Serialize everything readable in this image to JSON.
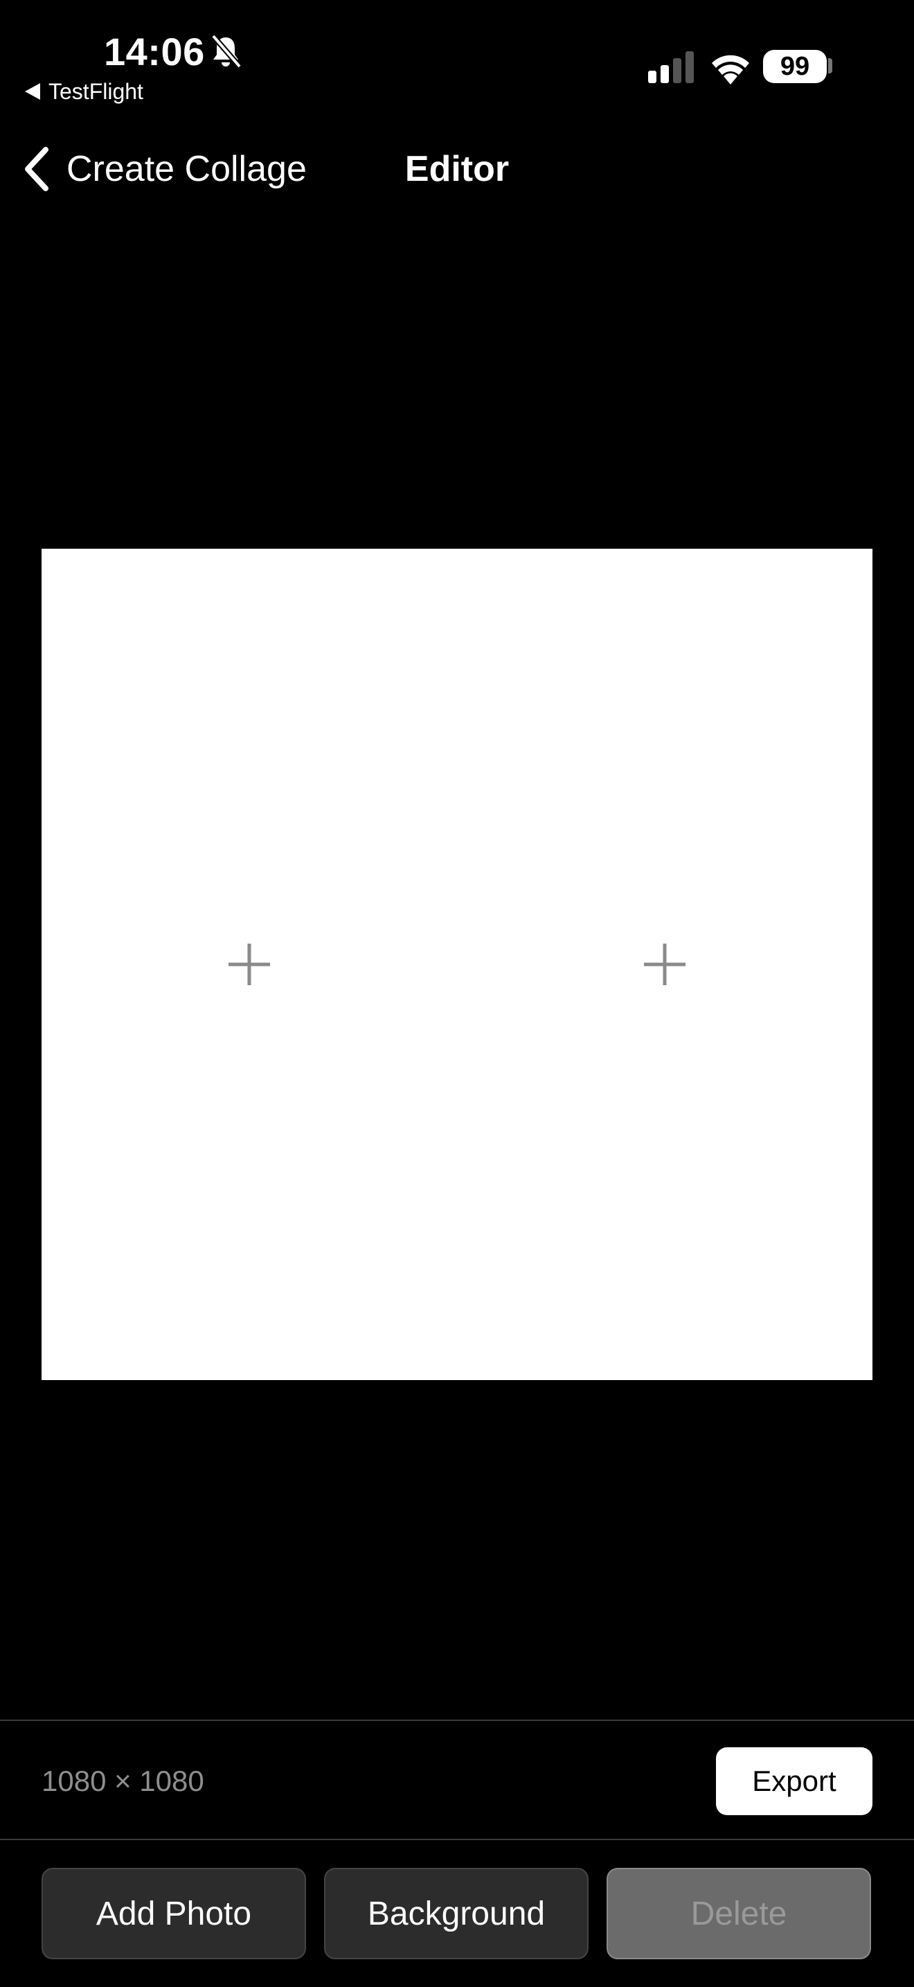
{
  "status_bar": {
    "time": "14:06",
    "back_app": "TestFlight",
    "battery_level": "99",
    "icons": [
      "bell-slash-icon",
      "signal-icon",
      "wifi-icon",
      "battery-icon"
    ]
  },
  "nav": {
    "back_label": "Create Collage",
    "title": "Editor"
  },
  "canvas": {
    "background_color": "#ffffff",
    "slots": [
      {
        "icon": "plus-icon"
      },
      {
        "icon": "plus-icon"
      }
    ]
  },
  "footer": {
    "dimensions": "1080 × 1080",
    "export_label": "Export"
  },
  "toolbar": {
    "add_photo_label": "Add Photo",
    "background_label": "Background",
    "delete_label": "Delete"
  },
  "colors": {
    "page_background": "#000000",
    "button_background": "#2c2c2c",
    "disabled_button_background": "#6b6b6b",
    "muted_text": "#8e8e8e"
  }
}
